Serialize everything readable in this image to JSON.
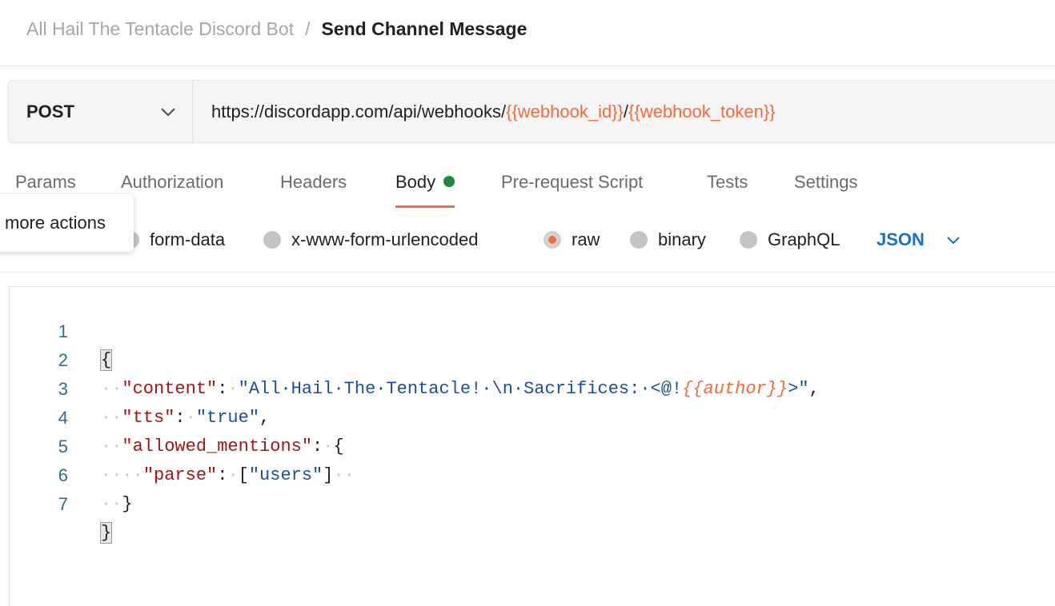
{
  "breadcrumb": {
    "parent": "All Hail The Tentacle Discord Bot",
    "separator": "/",
    "current": "Send Channel Message"
  },
  "request": {
    "method": "POST",
    "url_base": "https://discordapp.com/api/webhooks/",
    "url_var1": "{{webhook_id}}",
    "url_sep": "/",
    "url_var2": "{{webhook_token}}"
  },
  "tabs": [
    {
      "label": "Params"
    },
    {
      "label": "Authorization"
    },
    {
      "label": "Headers"
    },
    {
      "label": "Body",
      "active": true
    },
    {
      "label": "Pre-request Script"
    },
    {
      "label": "Tests"
    },
    {
      "label": "Settings"
    }
  ],
  "tooltip": "more actions",
  "body_types": {
    "options": [
      "form-data",
      "x-www-form-urlencoded",
      "raw",
      "binary",
      "GraphQL"
    ],
    "selected": "raw",
    "format": "JSON"
  },
  "editor": {
    "line_numbers": [
      "1",
      "2",
      "3",
      "4",
      "5",
      "6",
      "7"
    ],
    "lines": {
      "l1": "{",
      "l2_key": "\"content\"",
      "l2_colon": ":",
      "l2_val": "\"All·Hail·The·Tentacle!·\\n·Sacrifices:·<@!",
      "l2_var": "{{author}}",
      "l2_end": ">\"",
      "l2_comma": ",",
      "l3_key": "\"tts\"",
      "l3_colon": ":",
      "l3_val": "\"true\"",
      "l3_comma": ",",
      "l4_key": "\"allowed_mentions\"",
      "l4_colon": ":",
      "l4_brace": "{",
      "l5_key": "\"parse\"",
      "l5_colon": ":",
      "l5_open": "[",
      "l5_val": "\"users\"",
      "l5_close": "]",
      "l6": "}",
      "l7": "}"
    }
  },
  "colors": {
    "accent": "#f26b3a",
    "body_dot": "#1e8a3a",
    "json_label": "#1b6fc7",
    "json_key": "#a31515",
    "json_string": "#1b4f9c"
  },
  "icons": [
    "chevron-down-icon",
    "status-dot-icon",
    "radio-icon"
  ]
}
